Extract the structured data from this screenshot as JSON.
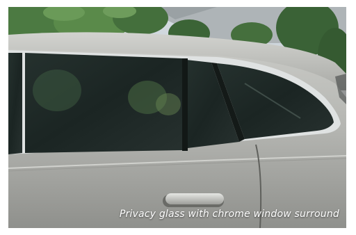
{
  "caption": "Privacy glass with chrome window surround",
  "colors": {
    "sky": "#cfd8df",
    "foliage": "#3f6a3a",
    "body_paint": "#b7b8b4",
    "body_shadow": "#8e8f8b",
    "glass": "#1c2624",
    "chrome": "#d9dcdc"
  }
}
